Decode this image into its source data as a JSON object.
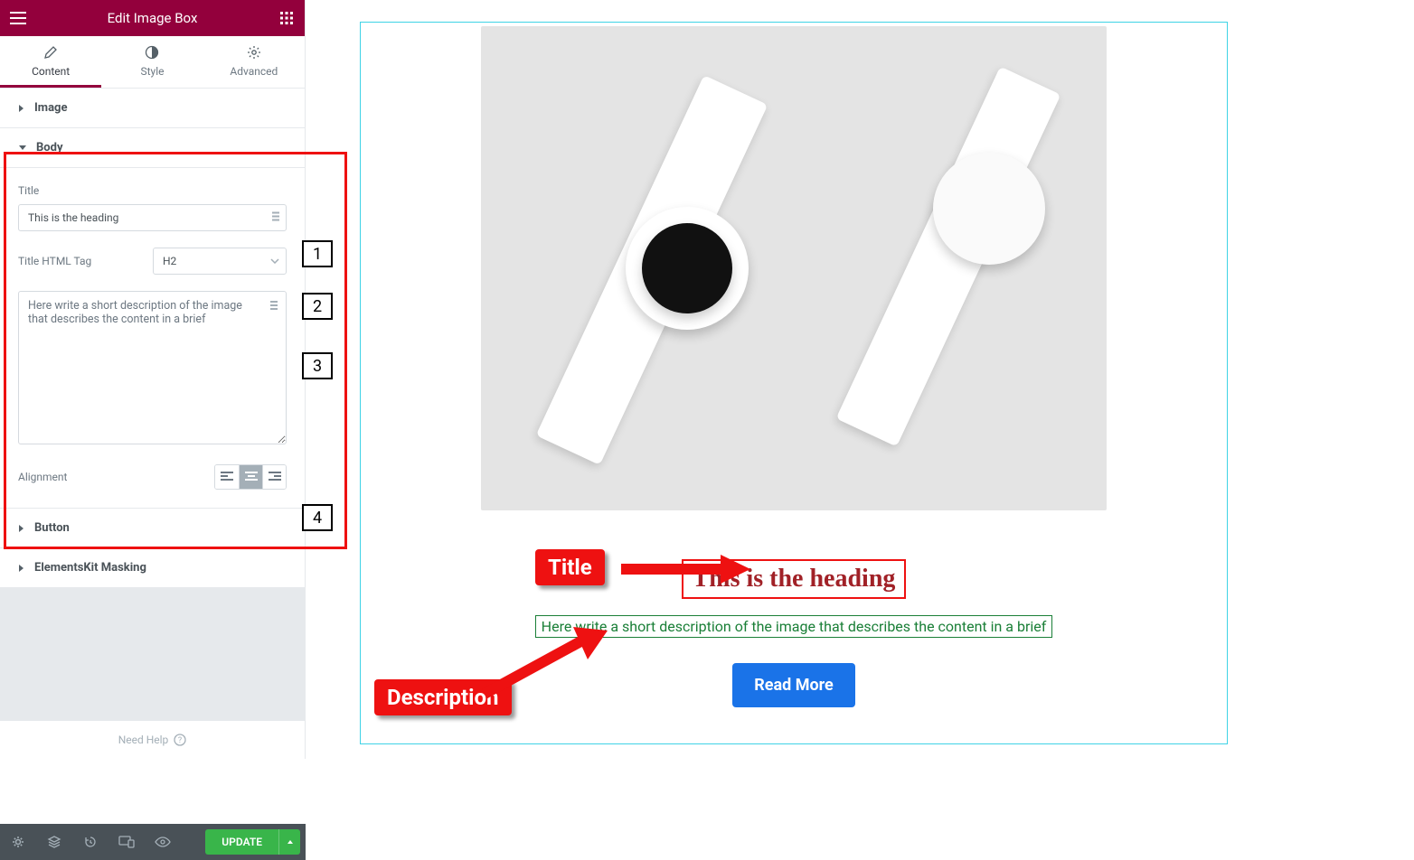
{
  "header": {
    "title": "Edit Image Box"
  },
  "tabs": {
    "content": "Content",
    "style": "Style",
    "advanced": "Advanced"
  },
  "sections": {
    "image": "Image",
    "body": "Body",
    "button": "Button",
    "masking": "ElementsKit Masking"
  },
  "body": {
    "title_label": "Title",
    "title_value": "This is the heading",
    "tag_label": "Title HTML Tag",
    "tag_value": "H2",
    "desc_value": "Here write a short description of the image that describes the content in a brief",
    "align_label": "Alignment"
  },
  "help": "Need Help",
  "footer": {
    "update": "UPDATE"
  },
  "preview": {
    "heading": "This is the heading",
    "description": "Here write a short description of the image that describes the content in a brief",
    "button": "Read More"
  },
  "annotations": {
    "m1": "1",
    "m2": "2",
    "m3": "3",
    "m4": "4",
    "title_badge": "Title",
    "desc_badge": "Description"
  }
}
